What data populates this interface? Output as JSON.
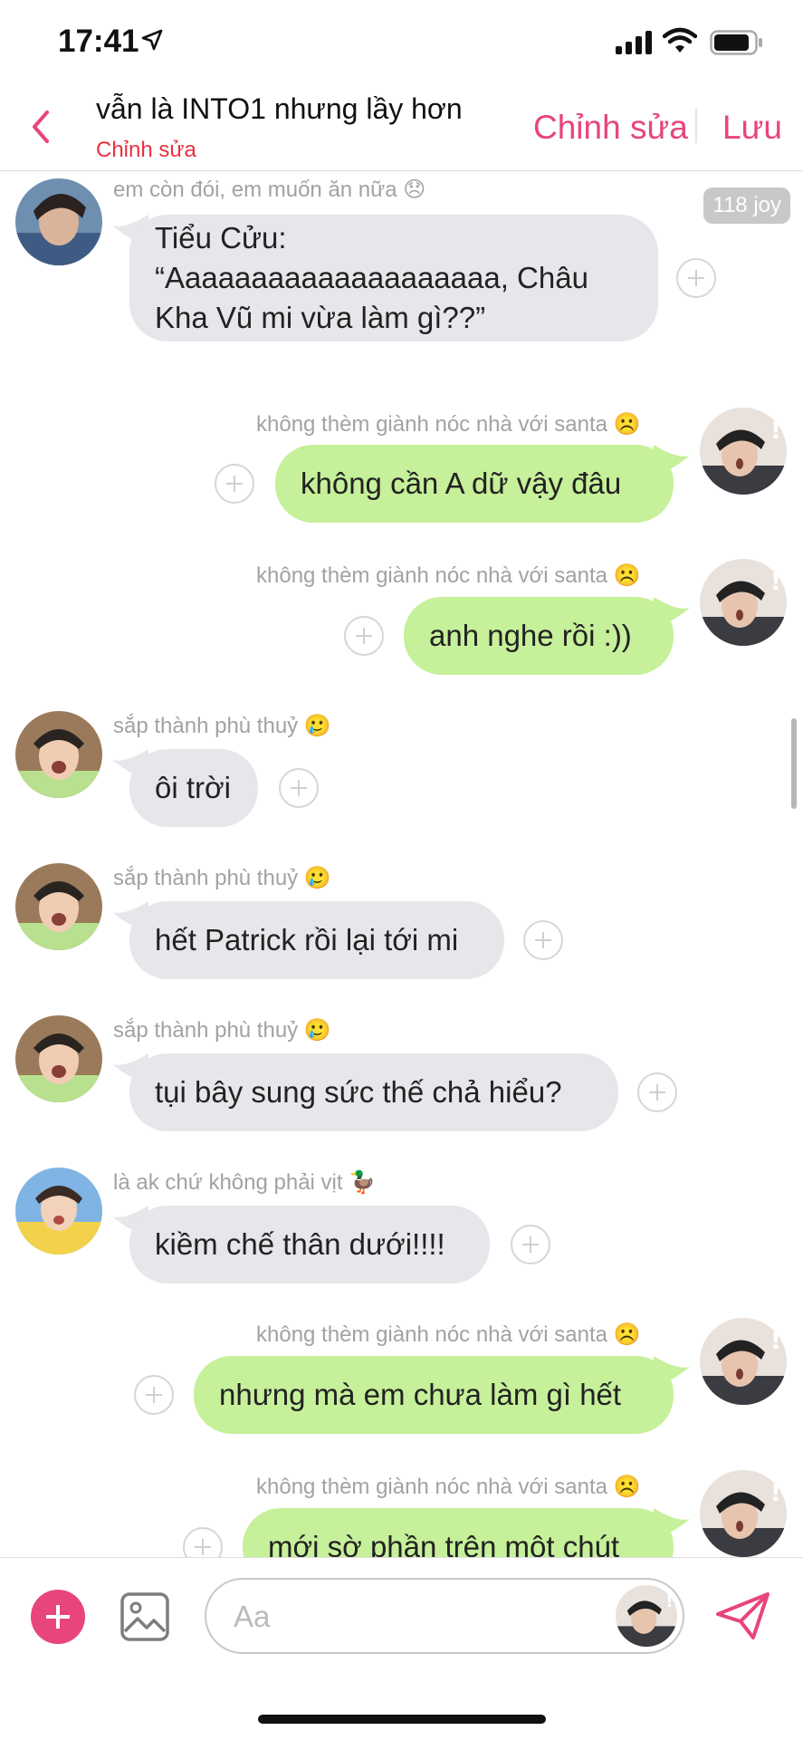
{
  "status": {
    "time": "17:41"
  },
  "header": {
    "title": "vẫn là INTO1 nhưng lầy hơn",
    "subtitle": "Chỉnh sửa",
    "edit_label": "Chỉnh sửa",
    "save_label": "Lưu"
  },
  "messages": [
    {
      "sender": "em còn đói, em muốn ăn nữa 😞",
      "line1": "Tiểu Cửu:",
      "line2": "“Aaaaaaaaaaaaaaaaaaaa, Châu",
      "line3": "Kha Vũ mi vừa làm gì??”",
      "badge": "118 joy"
    },
    {
      "sender": "không thèm giành nóc nhà với santa ☹️",
      "text": "không cần A dữ vậy đâu"
    },
    {
      "sender": "không thèm giành nóc nhà với santa ☹️",
      "text": "anh nghe rồi :))"
    },
    {
      "sender": "sắp thành phù thuỷ 🥲",
      "text": "ôi trời"
    },
    {
      "sender": "sắp thành phù thuỷ 🥲",
      "text": "hết Patrick rồi lại tới mi"
    },
    {
      "sender": "sắp thành phù thuỷ 🥲",
      "text": "tụi bây sung sức thế chả hiểu?"
    },
    {
      "sender": "là ak chứ không phải vịt 🦆",
      "text": "kiềm chế thân dưới!!!!"
    },
    {
      "sender": "không thèm giành nóc nhà với santa ☹️",
      "text": "nhưng mà em chưa làm gì hết"
    },
    {
      "sender": "không thèm giành nóc nhà với santa ☹️",
      "text": "mới sờ phần trên một chút"
    }
  ],
  "composer": {
    "placeholder": "Aa"
  },
  "colors": {
    "accent": "#e8447e",
    "incoming": "#e6e7ea",
    "outgoing": "#c6f09a",
    "subtitle": "#e8323e"
  }
}
